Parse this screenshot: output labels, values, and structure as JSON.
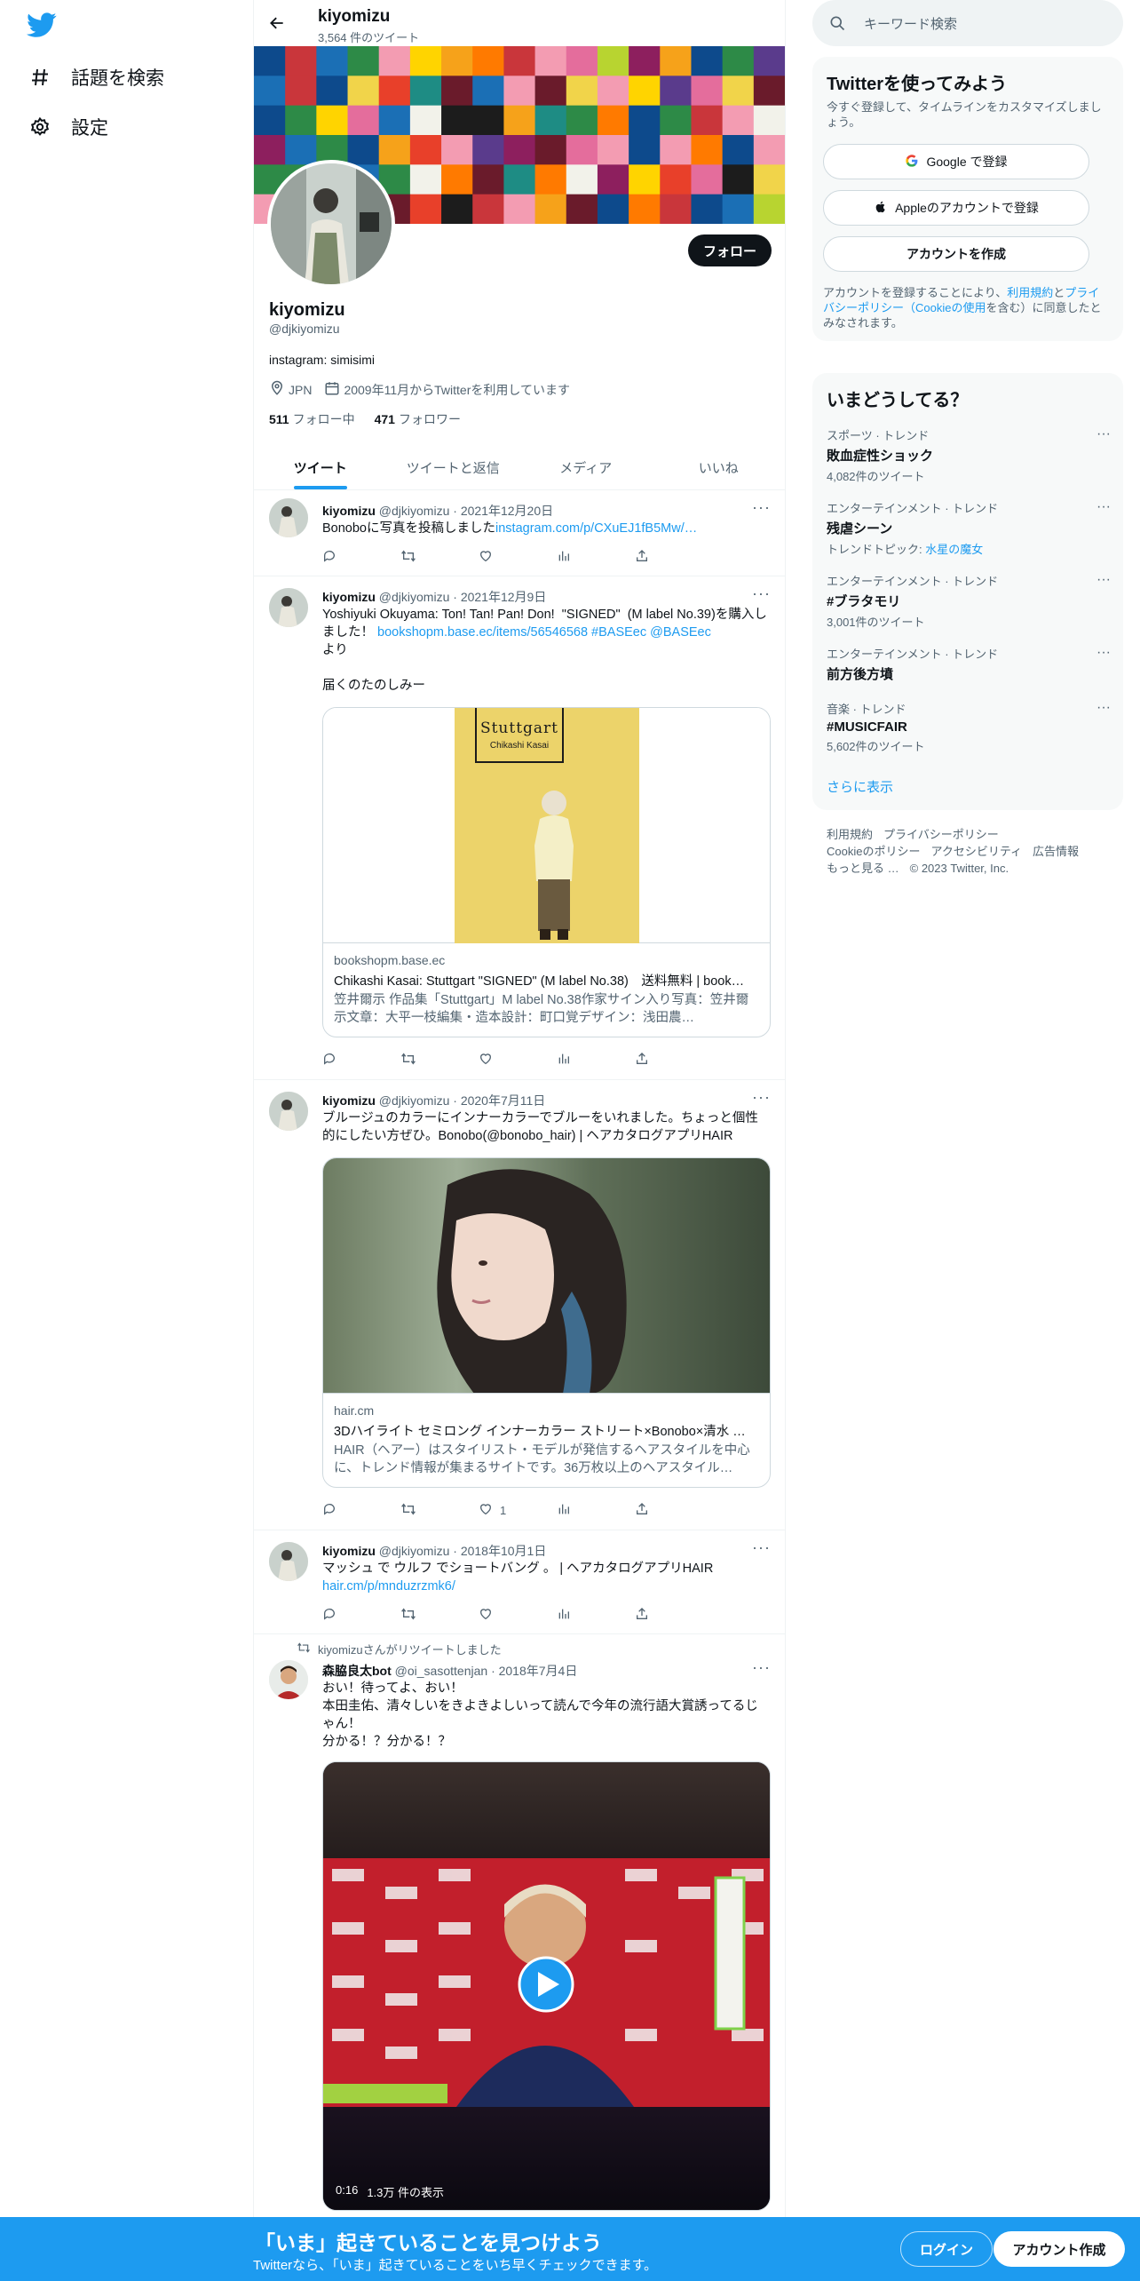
{
  "nav": {
    "explore_label": "話題を検索",
    "settings_label": "設定"
  },
  "profile": {
    "top_name": "kiyomizu",
    "tweet_count": "3,564 件のツイート",
    "name": "kiyomizu",
    "handle": "@djkiyomizu",
    "bio": "instagram: simisimi",
    "location": "JPN",
    "joined": "2009年11月からTwitterを利用しています",
    "following_count": "511",
    "following_label": "フォロー中",
    "followers_count": "471",
    "followers_label": "フォロワー",
    "follow_button": "フォロー"
  },
  "tabs": [
    "ツイート",
    "ツイートと返信",
    "メディア",
    "いいね"
  ],
  "tweets": [
    {
      "name": "kiyomizu",
      "handle": "@djkiyomizu",
      "date": "· 2021年12月20日",
      "text": "Bonoboに写真を投稿しました",
      "link": "instagram.com/p/CXuEJ1fB5Mw/…"
    },
    {
      "name": "kiyomizu",
      "handle": "@djkiyomizu",
      "date": "· 2021年12月9日",
      "text_a": "Yoshiyuki Okuyama: Ton! Tan! Pan! Don!  \"SIGNED\"  (M label No.39)を購入しました！ ",
      "link_a": "bookshopm.base.ec/items/56546568 #BASEec @BASEec",
      "text_b": "より\n\n届くのたのしみー",
      "card_domain": "bookshopm.base.ec",
      "card_title": "Chikashi Kasai: Stuttgart \"SIGNED\" (M label No.38)　送料無料 | book…",
      "card_desc": "笠井爾示 作品集「Stuttgart」M label No.38作家サイン入り写真：笠井爾示文章：大平一枝編集・造本設計：町口覚デザイン：浅田農…",
      "book_title": "Stuttgart",
      "book_author": "Chikashi Kasai"
    },
    {
      "name": "kiyomizu",
      "handle": "@djkiyomizu",
      "date": "· 2020年7月11日",
      "text": "ブルージュのカラーにインナーカラーでブルーをいれました。ちょっと個性的にしたい方ぜひ。Bonobo(@bonobo_hair) | ヘアカタログアプリHAIR",
      "card_domain": "hair.cm",
      "card_title": "3Dハイライト セミロング インナーカラー ストリート×Bonobo×清水 …",
      "card_desc": "HAIR（ヘアー）はスタイリスト・モデルが発信するヘアスタイルを中心に、トレンド情報が集まるサイトです。36万枚以上のヘアスタイル…",
      "like_count": "1"
    },
    {
      "name": "kiyomizu",
      "handle": "@djkiyomizu",
      "date": "· 2018年10月1日",
      "text": "マッシュ で ウルフ でショートバング 。 | ヘアカタログアプリHAIR",
      "link": "hair.cm/p/mnduzrzmk6/"
    },
    {
      "retweet_line": "kiyomizuさんがリツイートしました",
      "name": "森脇良太bot",
      "handle": "@oi_sasottenjan",
      "date": "· 2018年7月4日",
      "text": "おい！待ってよ、おい！\n本田圭佑、清々しいをきよきよしいって読んで今年の流行語大賞誘ってるじゃん！\n分かる！？分かる！？",
      "video_time": "0:16",
      "video_views": "1.3万 件の表示"
    }
  ],
  "search": {
    "placeholder": "キーワード検索"
  },
  "signup_panel": {
    "title": "Twitterを使ってみよう",
    "subtitle": "今すぐ登録して、タイムラインをカスタマイズしましょう。",
    "google_btn": "Google で登録",
    "apple_btn": "Appleのアカウントで登録",
    "create_btn": "アカウントを作成",
    "terms_a": "アカウントを登録することにより、",
    "terms_link1": "利用規約",
    "terms_b": "と",
    "terms_link2": "プライバシーポリシー（Cookieの使用",
    "terms_c": "を含む）に同意したとみなされます。"
  },
  "trends_panel": {
    "title": "いまどうしてる？",
    "show_more": "さらに表示",
    "items": [
      {
        "category": "スポーツ · トレンド",
        "name": "敗血症性ショック",
        "count": "4,082件のツイート"
      },
      {
        "category": "エンターテインメント · トレンド",
        "name": "残虐シーン",
        "count_label": "トレンドトピック: ",
        "count_link": "水星の魔女"
      },
      {
        "category": "エンターテインメント · トレンド",
        "name": "#ブラタモリ",
        "count": "3,001件のツイート"
      },
      {
        "category": "エンターテインメント · トレンド",
        "name": "前方後方墳"
      },
      {
        "category": "音楽 · トレンド",
        "name": "#MUSICFAIR",
        "count": "5,602件のツイート"
      }
    ]
  },
  "footer": {
    "line1": [
      "利用規約",
      "プライバシーポリシー"
    ],
    "line2": [
      "Cookieのポリシー",
      "アクセシビリティ",
      "広告情報"
    ],
    "line3": [
      "もっと見る …",
      "© 2023 Twitter, Inc."
    ]
  },
  "bottom_bar": {
    "title": "「いま」起きていることを見つけよう",
    "subtitle": "Twitterなら、「いま」起きていることをいち早くチェックできます。",
    "login": "ログイン",
    "signup": "アカウント作成"
  },
  "colors": {
    "accent": "#1d9bf0",
    "text": "#0f1419",
    "secondary": "#536471"
  }
}
